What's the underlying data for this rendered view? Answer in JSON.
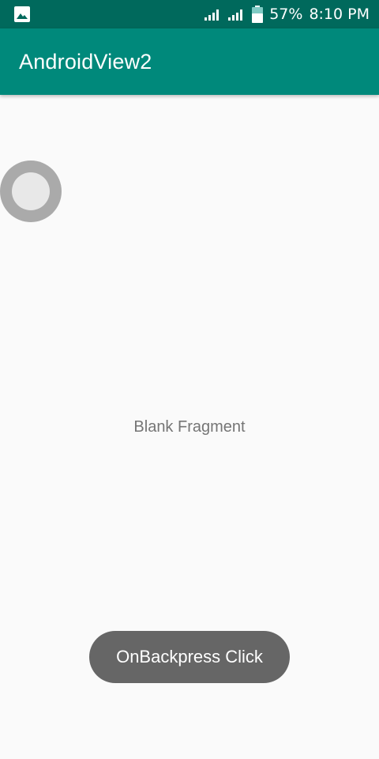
{
  "status_bar": {
    "battery": "57%",
    "time": "8:10 PM",
    "icons": [
      "image-icon",
      "signal-icon",
      "signal-icon",
      "battery-icon"
    ]
  },
  "app_bar": {
    "title": "AndroidView2"
  },
  "main": {
    "fragment_text": "Blank Fragment"
  },
  "toast": {
    "message": "OnBackpress Click"
  },
  "colors": {
    "status_bar": "#00695c",
    "app_bar": "#00897b",
    "background": "#fafafa",
    "toast": "#666666"
  }
}
